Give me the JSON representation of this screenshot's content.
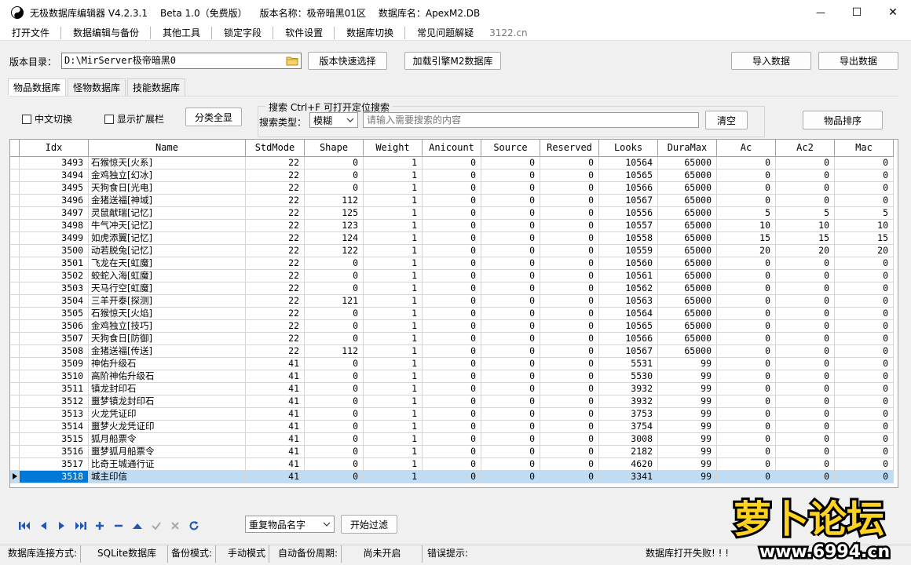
{
  "window": {
    "app_title": "无极数据库编辑器 V4.2.3.1",
    "beta": "Beta 1.0（免费版）",
    "version_name": "版本名称：极帝暗黑01区",
    "database": "数据库名：ApexM2.DB",
    "min_glyph": "—",
    "max_glyph": "☐",
    "close_glyph": "✕"
  },
  "menu": {
    "items": [
      "打开文件",
      "数据编辑与备份",
      "其他工具",
      "锁定字段",
      "软件设置",
      "数据库切换",
      "常见问题解疑"
    ],
    "watermark": "3122.cn"
  },
  "toolbar": {
    "dir_label": "版本目录：",
    "dir_value": "D:\\MirServer极帝暗黑0",
    "quick_select": "版本快速选择",
    "load_engine": "加载引擎M2数据库",
    "import": "导入数据",
    "export": "导出数据"
  },
  "tabs": [
    "物品数据库",
    "怪物数据库",
    "技能数据库"
  ],
  "filter": {
    "chinese_toggle": "中文切换",
    "show_extension": "显示扩展栏",
    "category_all": "分类全显",
    "search_title": "搜索   Ctrl+F 可打开定位搜索",
    "search_type_label": "搜索类型：",
    "search_type_value": "模糊",
    "search_placeholder": "请输入需要搜索的内容",
    "clear": "清空",
    "sort": "物品排序"
  },
  "grid": {
    "columns": [
      "Idx",
      "Name",
      "StdMode",
      "Shape",
      "Weight",
      "Anicount",
      "Source",
      "Reserved",
      "Looks",
      "DuraMax",
      "Ac",
      "Ac2",
      "Mac"
    ],
    "selected_idx": "3518",
    "rows": [
      [
        "3493",
        "石猴惊天[火系]",
        "22",
        "0",
        "1",
        "0",
        "0",
        "0",
        "10564",
        "65000",
        "0",
        "0",
        "0"
      ],
      [
        "3494",
        "金鸡独立[幻冰]",
        "22",
        "0",
        "1",
        "0",
        "0",
        "0",
        "10565",
        "65000",
        "0",
        "0",
        "0"
      ],
      [
        "3495",
        "天狗食日[光电]",
        "22",
        "0",
        "1",
        "0",
        "0",
        "0",
        "10566",
        "65000",
        "0",
        "0",
        "0"
      ],
      [
        "3496",
        "金猪送福[神域]",
        "22",
        "112",
        "1",
        "0",
        "0",
        "0",
        "10567",
        "65000",
        "0",
        "0",
        "0"
      ],
      [
        "3497",
        "灵鼠献瑞[记忆]",
        "22",
        "125",
        "1",
        "0",
        "0",
        "0",
        "10556",
        "65000",
        "5",
        "5",
        "5"
      ],
      [
        "3498",
        "牛气冲天[记忆]",
        "22",
        "123",
        "1",
        "0",
        "0",
        "0",
        "10557",
        "65000",
        "10",
        "10",
        "10"
      ],
      [
        "3499",
        "如虎添翼[记忆]",
        "22",
        "124",
        "1",
        "0",
        "0",
        "0",
        "10558",
        "65000",
        "15",
        "15",
        "15"
      ],
      [
        "3500",
        "动若脱兔[记忆]",
        "22",
        "122",
        "1",
        "0",
        "0",
        "0",
        "10559",
        "65000",
        "20",
        "20",
        "20"
      ],
      [
        "3501",
        "飞龙在天[虹魔]",
        "22",
        "0",
        "1",
        "0",
        "0",
        "0",
        "10560",
        "65000",
        "0",
        "0",
        "0"
      ],
      [
        "3502",
        "蛟蛇入海[虹魔]",
        "22",
        "0",
        "1",
        "0",
        "0",
        "0",
        "10561",
        "65000",
        "0",
        "0",
        "0"
      ],
      [
        "3503",
        "天马行空[虹魔]",
        "22",
        "0",
        "1",
        "0",
        "0",
        "0",
        "10562",
        "65000",
        "0",
        "0",
        "0"
      ],
      [
        "3504",
        "三羊开泰[探测]",
        "22",
        "121",
        "1",
        "0",
        "0",
        "0",
        "10563",
        "65000",
        "0",
        "0",
        "0"
      ],
      [
        "3505",
        "石猴惊天[火焰]",
        "22",
        "0",
        "1",
        "0",
        "0",
        "0",
        "10564",
        "65000",
        "0",
        "0",
        "0"
      ],
      [
        "3506",
        "金鸡独立[技巧]",
        "22",
        "0",
        "1",
        "0",
        "0",
        "0",
        "10565",
        "65000",
        "0",
        "0",
        "0"
      ],
      [
        "3507",
        "天狗食日[防御]",
        "22",
        "0",
        "1",
        "0",
        "0",
        "0",
        "10566",
        "65000",
        "0",
        "0",
        "0"
      ],
      [
        "3508",
        "金猪送福[传送]",
        "22",
        "112",
        "1",
        "0",
        "0",
        "0",
        "10567",
        "65000",
        "0",
        "0",
        "0"
      ],
      [
        "3509",
        "神佑升级石",
        "41",
        "0",
        "1",
        "0",
        "0",
        "0",
        "5531",
        "99",
        "0",
        "0",
        "0"
      ],
      [
        "3510",
        "高阶神佑升级石",
        "41",
        "0",
        "1",
        "0",
        "0",
        "0",
        "5530",
        "99",
        "0",
        "0",
        "0"
      ],
      [
        "3511",
        "镇龙封印石",
        "41",
        "0",
        "1",
        "0",
        "0",
        "0",
        "3932",
        "99",
        "0",
        "0",
        "0"
      ],
      [
        "3512",
        "噩梦镇龙封印石",
        "41",
        "0",
        "1",
        "0",
        "0",
        "0",
        "3932",
        "99",
        "0",
        "0",
        "0"
      ],
      [
        "3513",
        "火龙凭证印",
        "41",
        "0",
        "1",
        "0",
        "0",
        "0",
        "3753",
        "99",
        "0",
        "0",
        "0"
      ],
      [
        "3514",
        "噩梦火龙凭证印",
        "41",
        "0",
        "1",
        "0",
        "0",
        "0",
        "3754",
        "99",
        "0",
        "0",
        "0"
      ],
      [
        "3515",
        "狐月船票令",
        "41",
        "0",
        "1",
        "0",
        "0",
        "0",
        "3008",
        "99",
        "0",
        "0",
        "0"
      ],
      [
        "3516",
        "噩梦狐月船票令",
        "41",
        "0",
        "1",
        "0",
        "0",
        "0",
        "2182",
        "99",
        "0",
        "0",
        "0"
      ],
      [
        "3517",
        "比奇王城通行证",
        "41",
        "0",
        "1",
        "0",
        "0",
        "0",
        "4620",
        "99",
        "0",
        "0",
        "0"
      ],
      [
        "3518",
        "城主印信",
        "41",
        "0",
        "1",
        "0",
        "0",
        "0",
        "3341",
        "99",
        "0",
        "0",
        "0"
      ]
    ]
  },
  "nav": {
    "icons": [
      "first-icon",
      "prev-icon",
      "next-icon",
      "last-icon",
      "add-icon",
      "remove-icon",
      "up-icon",
      "confirm-icon",
      "cancel-icon",
      "refresh-icon"
    ],
    "filter_select": "重复物品名字",
    "start_filter": "开始过滤"
  },
  "status": {
    "conn_label": "数据库连接方式:",
    "conn_value": "SQLite数据库",
    "backup_label": "备份模式:",
    "backup_value": "手动模式",
    "auto_backup_label": "自动备份周期:",
    "auto_backup_value": "尚未开启",
    "error_label": "错误提示:",
    "error_value": "数据库打开失败! ! !"
  },
  "logo": {
    "text": "萝卜论坛",
    "url": "www.6994.cn"
  }
}
